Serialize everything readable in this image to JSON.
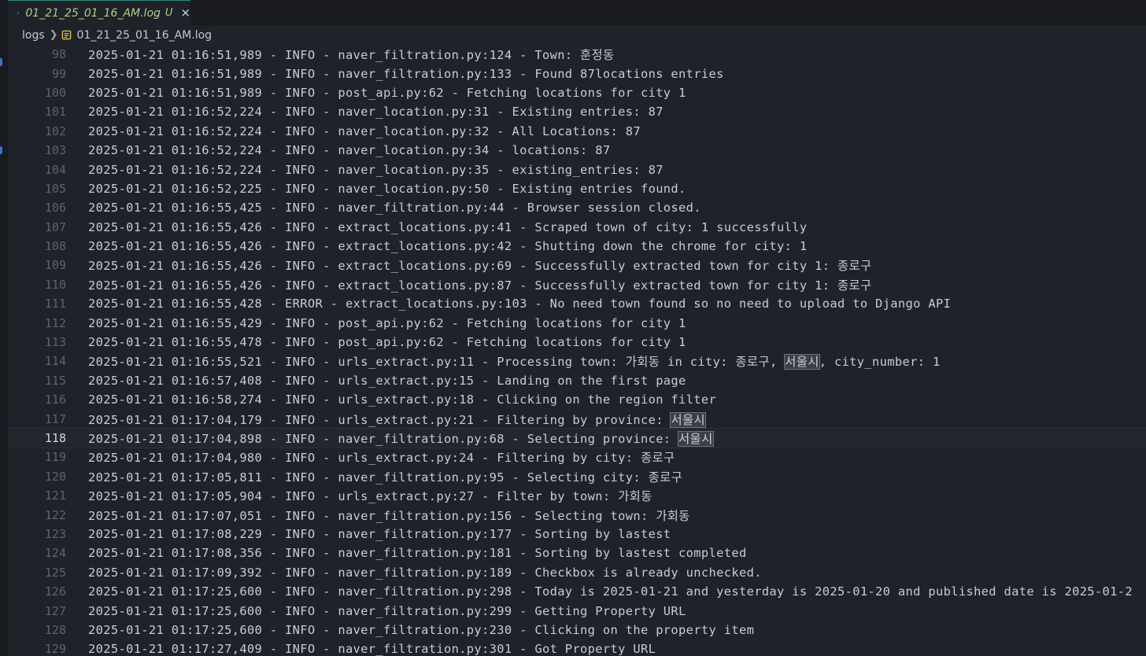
{
  "tab": {
    "title": "01_21_25_01_16_AM.log",
    "modified": "U",
    "close": "×"
  },
  "breadcrumb": {
    "folder": "logs",
    "file": "01_21_25_01_16_AM.log"
  },
  "highlight_term": "서울시",
  "current_line": 118,
  "lines": [
    {
      "n": "98",
      "text": "2025-01-21 01:16:51,989 - INFO - naver_filtration.py:124 - Town: 훈정동"
    },
    {
      "n": "99",
      "text": "2025-01-21 01:16:51,989 - INFO - naver_filtration.py:133 - Found 87locations entries"
    },
    {
      "n": "100",
      "text": "2025-01-21 01:16:51,989 - INFO - post_api.py:62 - Fetching locations for city 1"
    },
    {
      "n": "101",
      "text": "2025-01-21 01:16:52,224 - INFO - naver_location.py:31 - Existing entries: 87"
    },
    {
      "n": "102",
      "text": "2025-01-21 01:16:52,224 - INFO - naver_location.py:32 - All Locations: 87"
    },
    {
      "n": "103",
      "text": "2025-01-21 01:16:52,224 - INFO - naver_location.py:34 - locations: 87"
    },
    {
      "n": "104",
      "text": "2025-01-21 01:16:52,224 - INFO - naver_location.py:35 - existing_entries: 87"
    },
    {
      "n": "105",
      "text": "2025-01-21 01:16:52,225 - INFO - naver_location.py:50 - Existing entries found."
    },
    {
      "n": "106",
      "text": "2025-01-21 01:16:55,425 - INFO - naver_filtration.py:44 - Browser session closed."
    },
    {
      "n": "107",
      "text": "2025-01-21 01:16:55,426 - INFO - extract_locations.py:41 - Scraped town of city: 1 successfully"
    },
    {
      "n": "108",
      "text": "2025-01-21 01:16:55,426 - INFO - extract_locations.py:42 - Shutting down the chrome for city: 1"
    },
    {
      "n": "109",
      "text": "2025-01-21 01:16:55,426 - INFO - extract_locations.py:69 - Successfully extracted town for city 1: 종로구"
    },
    {
      "n": "110",
      "text": "2025-01-21 01:16:55,426 - INFO - extract_locations.py:87 - Successfully extracted town for city 1: 종로구"
    },
    {
      "n": "111",
      "text": "2025-01-21 01:16:55,428 - ERROR - extract_locations.py:103 - No need town found so no need to upload to Django API"
    },
    {
      "n": "112",
      "text": "2025-01-21 01:16:55,429 - INFO - post_api.py:62 - Fetching locations for city 1"
    },
    {
      "n": "113",
      "text": "2025-01-21 01:16:55,478 - INFO - post_api.py:62 - Fetching locations for city 1"
    },
    {
      "n": "114",
      "text": "2025-01-21 01:16:55,521 - INFO - urls_extract.py:11 - Processing town: 가회동 in city: 종로구, 서울시, city_number: 1"
    },
    {
      "n": "115",
      "text": "2025-01-21 01:16:57,408 - INFO - urls_extract.py:15 - Landing on the first page"
    },
    {
      "n": "116",
      "text": "2025-01-21 01:16:58,274 - INFO - urls_extract.py:18 - Clicking on the region filter"
    },
    {
      "n": "117",
      "text": "2025-01-21 01:17:04,179 - INFO - urls_extract.py:21 - Filtering by province: 서울시"
    },
    {
      "n": "118",
      "text": "2025-01-21 01:17:04,898 - INFO - naver_filtration.py:68 - Selecting province: 서울시"
    },
    {
      "n": "119",
      "text": "2025-01-21 01:17:04,980 - INFO - urls_extract.py:24 - Filtering by city: 종로구"
    },
    {
      "n": "120",
      "text": "2025-01-21 01:17:05,811 - INFO - naver_filtration.py:95 - Selecting city: 종로구"
    },
    {
      "n": "121",
      "text": "2025-01-21 01:17:05,904 - INFO - urls_extract.py:27 - Filter by town: 가회동"
    },
    {
      "n": "122",
      "text": "2025-01-21 01:17:07,051 - INFO - naver_filtration.py:156 - Selecting town: 가회동"
    },
    {
      "n": "123",
      "text": "2025-01-21 01:17:08,229 - INFO - naver_filtration.py:177 - Sorting by lastest"
    },
    {
      "n": "124",
      "text": "2025-01-21 01:17:08,356 - INFO - naver_filtration.py:181 - Sorting by lastest completed"
    },
    {
      "n": "125",
      "text": "2025-01-21 01:17:09,392 - INFO - naver_filtration.py:189 - Checkbox is already unchecked."
    },
    {
      "n": "126",
      "text": "2025-01-21 01:17:25,600 - INFO - naver_filtration.py:298 - Today is 2025-01-21 and yesterday is 2025-01-20 and published date is 2025-01-2"
    },
    {
      "n": "127",
      "text": "2025-01-21 01:17:25,600 - INFO - naver_filtration.py:299 - Getting Property URL"
    },
    {
      "n": "128",
      "text": "2025-01-21 01:17:25,600 - INFO - naver_filtration.py:230 - Clicking on the property item"
    },
    {
      "n": "129",
      "text": "2025-01-21 01:17:27,409 - INFO - naver_filtration.py:301 - Got Property URL"
    }
  ]
}
